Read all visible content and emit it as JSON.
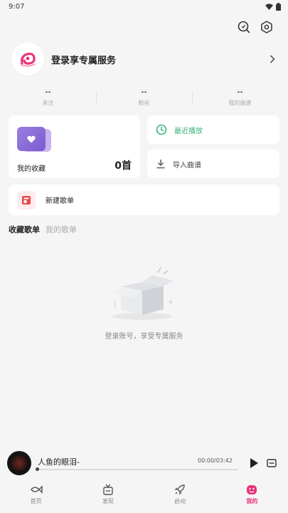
{
  "status_bar": {
    "time": "9:07"
  },
  "profile": {
    "login_label": "登录享专属服务"
  },
  "stats": [
    {
      "value": "--",
      "label": "关注"
    },
    {
      "value": "--",
      "label": "粉丝"
    },
    {
      "value": "--",
      "label": "我的曲谱"
    }
  ],
  "favorites": {
    "label": "我的收藏",
    "count": "0首"
  },
  "recent": {
    "label": "最近播放"
  },
  "import": {
    "label": "导入曲谱"
  },
  "new_playlist": {
    "label": "新建歌单"
  },
  "tabs": [
    {
      "label": "收藏歌单",
      "active": true
    },
    {
      "label": "我的歌单",
      "active": false
    }
  ],
  "empty_state": {
    "text": "登录账号，享受专属服务"
  },
  "player": {
    "title": "人鱼的眼泪-",
    "time": "00:00/03:42",
    "progress": 0
  },
  "nav": [
    {
      "label": "首页",
      "icon": "fish-icon"
    },
    {
      "label": "发现",
      "icon": "box-icon"
    },
    {
      "label": "启动",
      "icon": "rocket-icon"
    },
    {
      "label": "我的",
      "icon": "pig-icon"
    }
  ],
  "colors": {
    "accent": "#e8337b",
    "green": "#3bb27a",
    "purple": "#8a6fd9"
  }
}
